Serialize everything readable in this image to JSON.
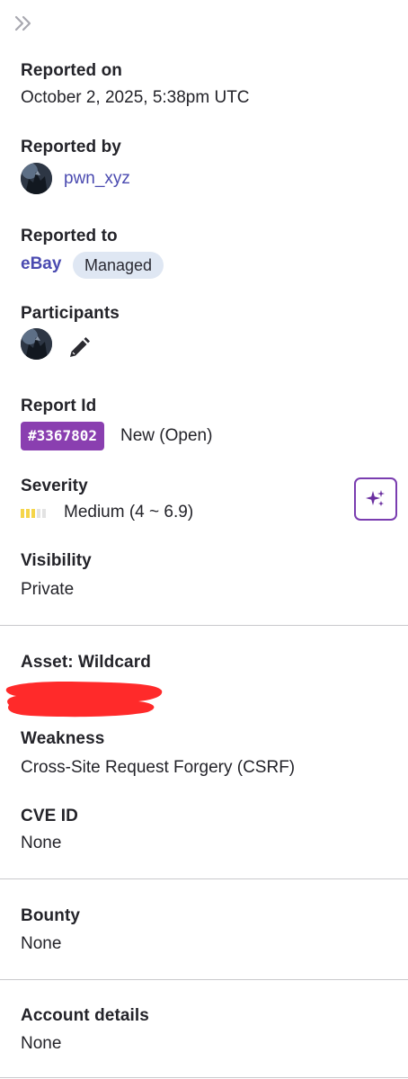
{
  "reported_on": {
    "label": "Reported on",
    "value": "October 2, 2025, 5:38pm UTC"
  },
  "reported_by": {
    "label": "Reported by",
    "username": "pwn_xyz"
  },
  "reported_to": {
    "label": "Reported to",
    "program": "eBay",
    "badge": "Managed"
  },
  "participants": {
    "label": "Participants",
    "edit_icon": "pencil-icon"
  },
  "report_id": {
    "label": "Report Id",
    "id": "#3367802",
    "status": "New (Open)"
  },
  "severity": {
    "label": "Severity",
    "value": "Medium (4 ~ 6.9)",
    "level_filled": 3,
    "level_total": 5,
    "colors": {
      "filled": "#f5d54a",
      "empty": "#e3e3e3"
    },
    "ai_icon": "sparkles-icon"
  },
  "visibility": {
    "label": "Visibility",
    "value": "Private"
  },
  "asset": {
    "label": "Asset: Wildcard"
  },
  "weakness": {
    "label": "Weakness",
    "value": "Cross-Site Request Forgery (CSRF)"
  },
  "cve": {
    "label": "CVE ID",
    "value": "None"
  },
  "bounty": {
    "label": "Bounty",
    "value": "None"
  },
  "account_details": {
    "label": "Account details",
    "value": "None"
  },
  "colors": {
    "link": "#4a4ab0",
    "report_badge": "#8a3fb0",
    "managed_chip": "#dfe7f3",
    "ai_button_border": "#7a3db0",
    "redaction": "#ff2a2a"
  }
}
